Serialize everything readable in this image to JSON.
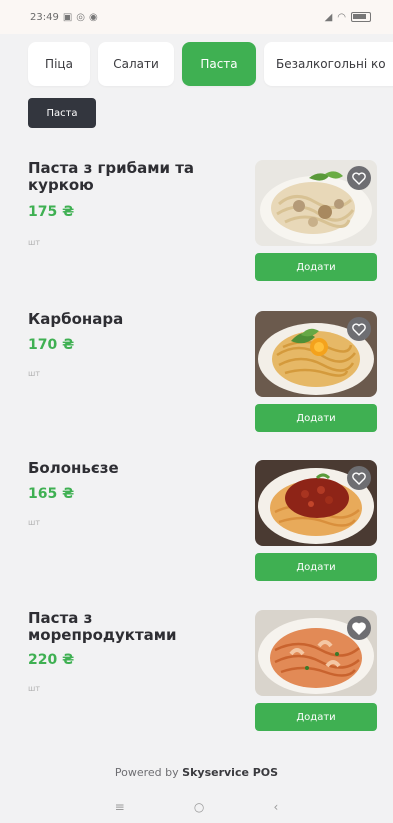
{
  "status_bar": {
    "time": "23:49"
  },
  "tabs": [
    {
      "label": "Піца",
      "active": false
    },
    {
      "label": "Салати",
      "active": false
    },
    {
      "label": "Паста",
      "active": true
    },
    {
      "label": "Безалкогольні ко",
      "active": false
    }
  ],
  "subcategory": {
    "label": "Паста"
  },
  "items": [
    {
      "title": "Паста з грибами та куркою",
      "price": "175 ₴",
      "unit": "шт",
      "button": "Додати",
      "favorite": false,
      "image": "pasta-mushroom-chicken"
    },
    {
      "title": "Карбонара",
      "price": "170 ₴",
      "unit": "шт",
      "button": "Додати",
      "favorite": false,
      "image": "carbonara"
    },
    {
      "title": "Болоньєзе",
      "price": "165 ₴",
      "unit": "шт",
      "button": "Додати",
      "favorite": false,
      "image": "bolognese"
    },
    {
      "title": "Паста з морепродуктами",
      "price": "220 ₴",
      "unit": "шт",
      "button": "Додати",
      "favorite": true,
      "image": "seafood-pasta"
    }
  ],
  "footer": {
    "prefix": "Powered by",
    "brand": "Skyservice POS"
  },
  "nav": {
    "menu_icon": "≡",
    "home_icon": "○",
    "back_icon": "‹"
  },
  "colors": {
    "accent": "#3fb052",
    "chip": "#33363e",
    "heart_bg": "#6e6e72"
  }
}
